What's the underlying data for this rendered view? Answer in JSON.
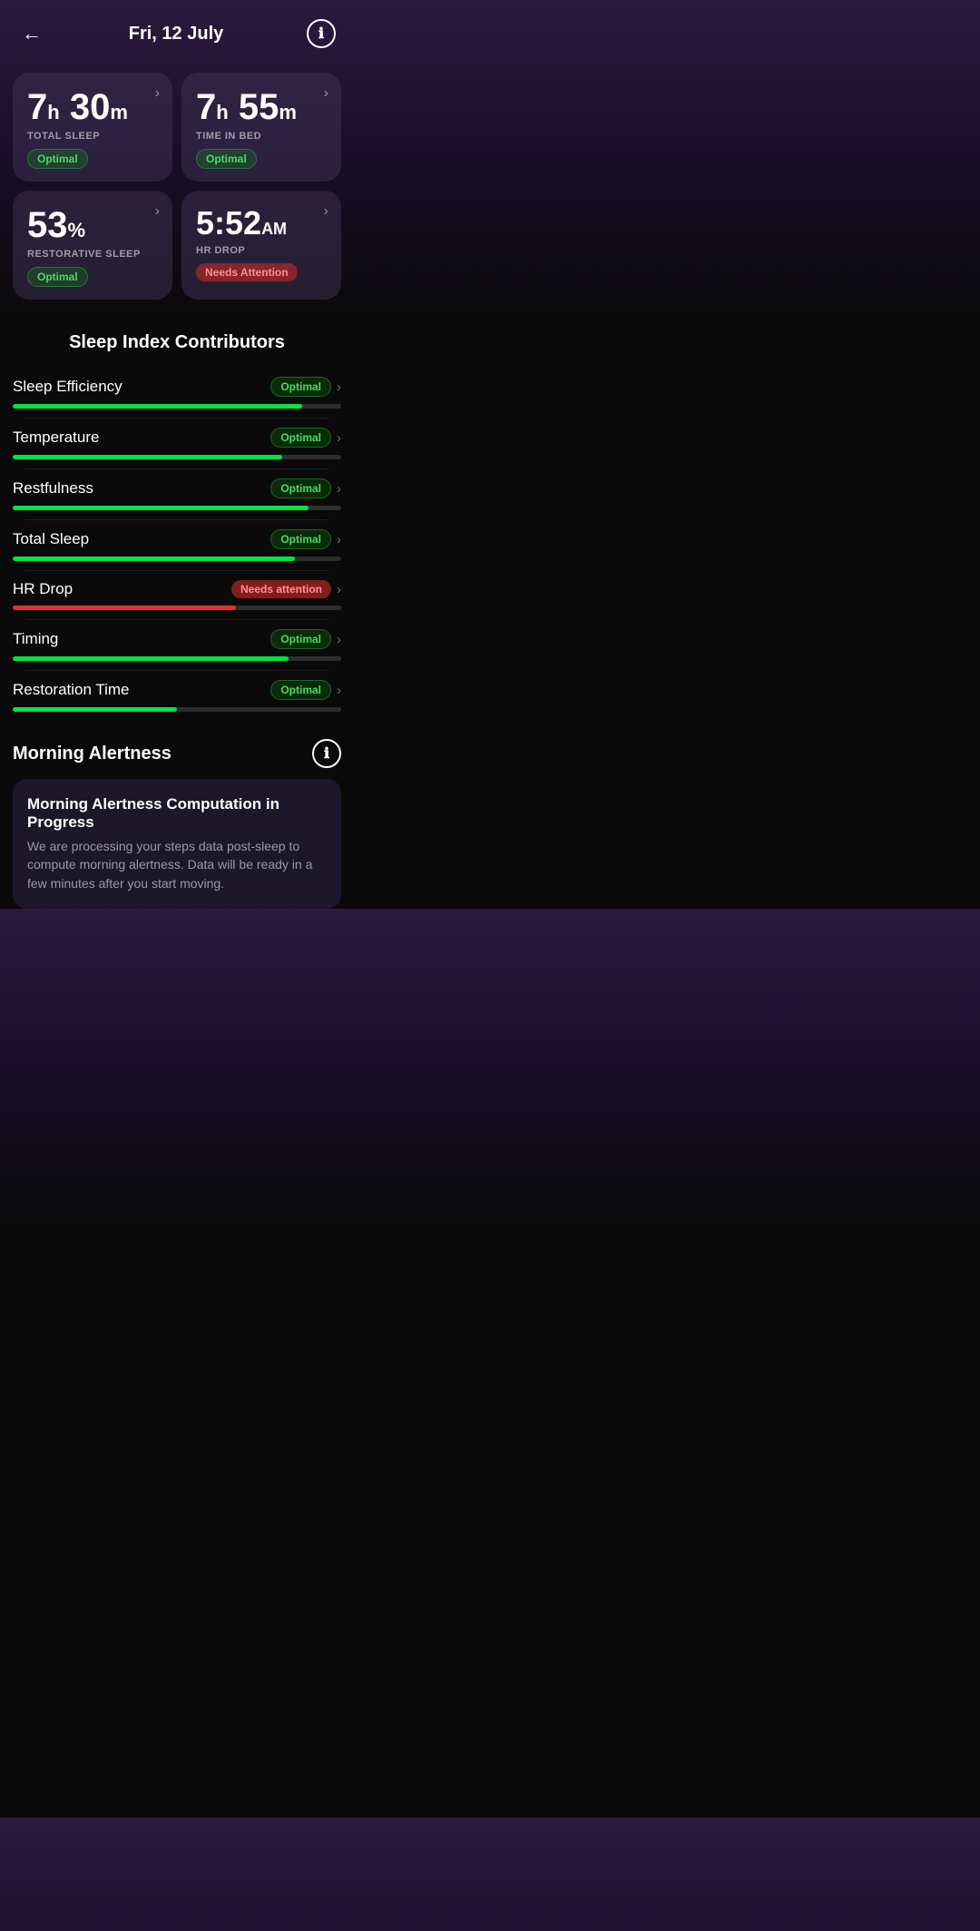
{
  "header": {
    "back_label": "←",
    "title": "Fri, 12 July",
    "info_icon": "ℹ"
  },
  "stats": [
    {
      "value": "7",
      "value_unit": "h",
      "value2": "30",
      "value2_unit": "m",
      "label": "TOTAL SLEEP",
      "badge": "Optimal",
      "badge_type": "optimal",
      "type": "duration"
    },
    {
      "value": "7",
      "value_unit": "h",
      "value2": "55",
      "value2_unit": "m",
      "label": "TIME IN BED",
      "badge": "Optimal",
      "badge_type": "optimal",
      "type": "duration"
    },
    {
      "value": "53",
      "value_unit": "%",
      "label": "RESTORATIVE SLEEP",
      "badge": "Optimal",
      "badge_type": "optimal",
      "type": "percent"
    },
    {
      "value": "5:52",
      "value_unit": "AM",
      "label": "HR DROP",
      "badge": "Needs Attention",
      "badge_type": "attention",
      "type": "time"
    }
  ],
  "contributors_section_title": "Sleep Index Contributors",
  "contributors": [
    {
      "name": "Sleep Efficiency",
      "status": "Optimal",
      "status_type": "optimal",
      "fill_pct": 88,
      "fill_color": "green"
    },
    {
      "name": "Temperature",
      "status": "Optimal",
      "status_type": "optimal",
      "fill_pct": 82,
      "fill_color": "green"
    },
    {
      "name": "Restfulness",
      "status": "Optimal",
      "status_type": "optimal",
      "fill_pct": 90,
      "fill_color": "green"
    },
    {
      "name": "Total Sleep",
      "status": "Optimal",
      "status_type": "optimal",
      "fill_pct": 86,
      "fill_color": "green"
    },
    {
      "name": "HR Drop",
      "status": "Needs attention",
      "status_type": "attention",
      "fill_pct": 68,
      "fill_color": "red"
    },
    {
      "name": "Timing",
      "status": "Optimal",
      "status_type": "optimal",
      "fill_pct": 84,
      "fill_color": "green"
    },
    {
      "name": "Restoration Time",
      "status": "Optimal",
      "status_type": "optimal",
      "fill_pct": 50,
      "fill_color": "green"
    }
  ],
  "morning_alertness": {
    "section_title": "Morning Alertness",
    "info_icon": "ℹ",
    "card_title": "Morning Alertness Computation in Progress",
    "card_text": "We are processing your steps data post-sleep to compute morning alertness. Data will be ready in a few minutes after you start moving."
  }
}
